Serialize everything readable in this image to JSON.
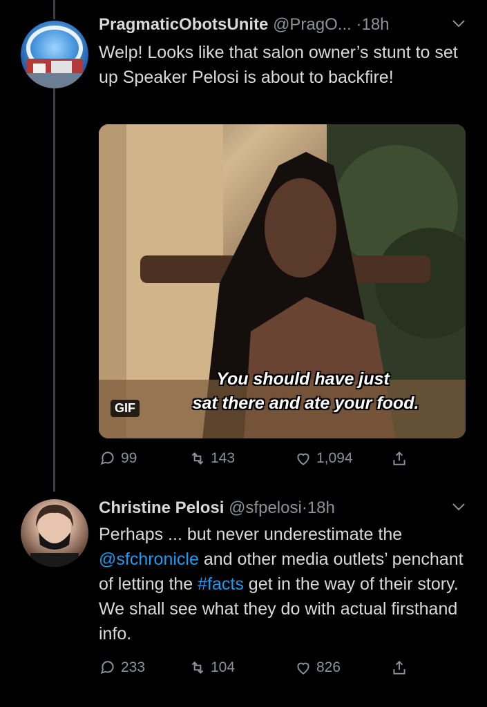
{
  "tweets": [
    {
      "name": "PragmaticObotsUnite",
      "handle": "@PragO...",
      "separator": "·",
      "time": "18h",
      "text": "Welp! Looks like that salon owner’s stunt to set up Speaker Pelosi is about to backfire!",
      "media": {
        "badge": "GIF",
        "caption_line1": "You should have just",
        "caption_line2": "sat there and ate your food."
      },
      "replies": "99",
      "retweets": "143",
      "likes": "1,094"
    },
    {
      "name": "Christine Pelosi",
      "handle": "@sfpelosi",
      "separator": "·",
      "time": "18h",
      "text_parts": {
        "p1": "Perhaps ... but never  underestimate the ",
        "mention": "@sfchronicle",
        "p2": " and other media outlets’ penchant of letting the ",
        "hashtag": "#facts",
        "p3": " get in the way of their story.  We shall see what they do with actual firsthand info."
      },
      "replies": "233",
      "retweets": "104",
      "likes": "826"
    }
  ],
  "icons": {
    "reply": "reply-icon",
    "retweet": "retweet-icon",
    "like": "heart-icon",
    "share": "share-icon",
    "more": "chevron-down-icon"
  },
  "colors": {
    "background": "#000000",
    "text": "#d9d9d9",
    "muted": "#8b9299",
    "link": "#1d9bf0"
  }
}
